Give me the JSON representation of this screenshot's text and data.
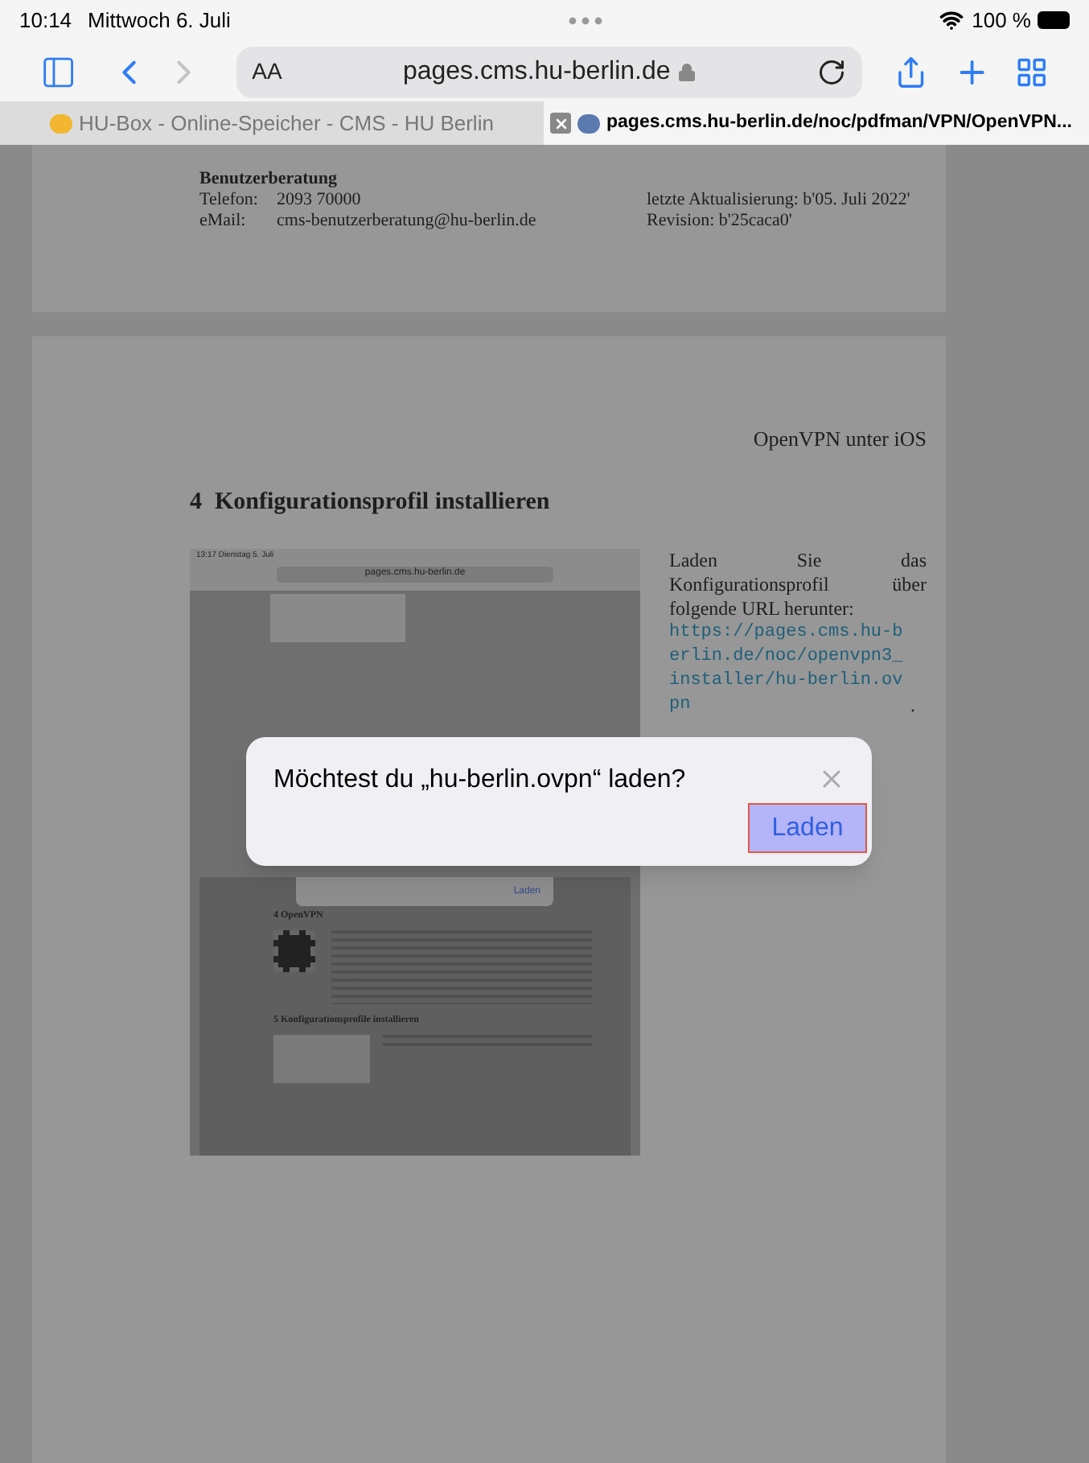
{
  "status_bar": {
    "time": "10:14",
    "date": "Mittwoch 6. Juli",
    "battery": "100 %"
  },
  "toolbar": {
    "text_size": "AA",
    "address": "pages.cms.hu-berlin.de"
  },
  "tabs": [
    {
      "title": "HU-Box - Online-Speicher - CMS - HU Berlin",
      "selected": false
    },
    {
      "title": "pages.cms.hu-berlin.de/noc/pdfman/VPN/OpenVPN...",
      "selected": true
    }
  ],
  "page_1": {
    "contact_heading": "Benutzerberatung",
    "phone_label": "Telefon:",
    "phone": "2093 70000",
    "email_label": "eMail:",
    "email": "cms-benutzerberatung@hu-berlin.de",
    "updated": "letzte Aktualisierung: b'05. Juli 2022'",
    "revision": "Revision: b'25caca0'"
  },
  "page_2": {
    "running_head": "OpenVPN unter iOS",
    "section_number": "4",
    "section_title": "Konfigurationsprofil installieren",
    "screenshot": {
      "time": "13:17 Dienstag 5. Juli",
      "address": "pages.cms.hu-berlin.de",
      "dialog_button": "Laden",
      "heading_1": "4 OpenVPN",
      "heading_2": "5 Konfigurationsprofile installieren"
    },
    "body": "Laden Sie das Konfigurationsprofil über folgende URL herunter:",
    "link": "https://pages.cms.hu-berlin.de/noc/openvpn3_installer/hu-berlin.ovpn",
    "body_end": "."
  },
  "dialog": {
    "message": "Möchtest du „hu-berlin.ovpn“ laden?",
    "button": "Laden",
    "button_selected": true
  }
}
